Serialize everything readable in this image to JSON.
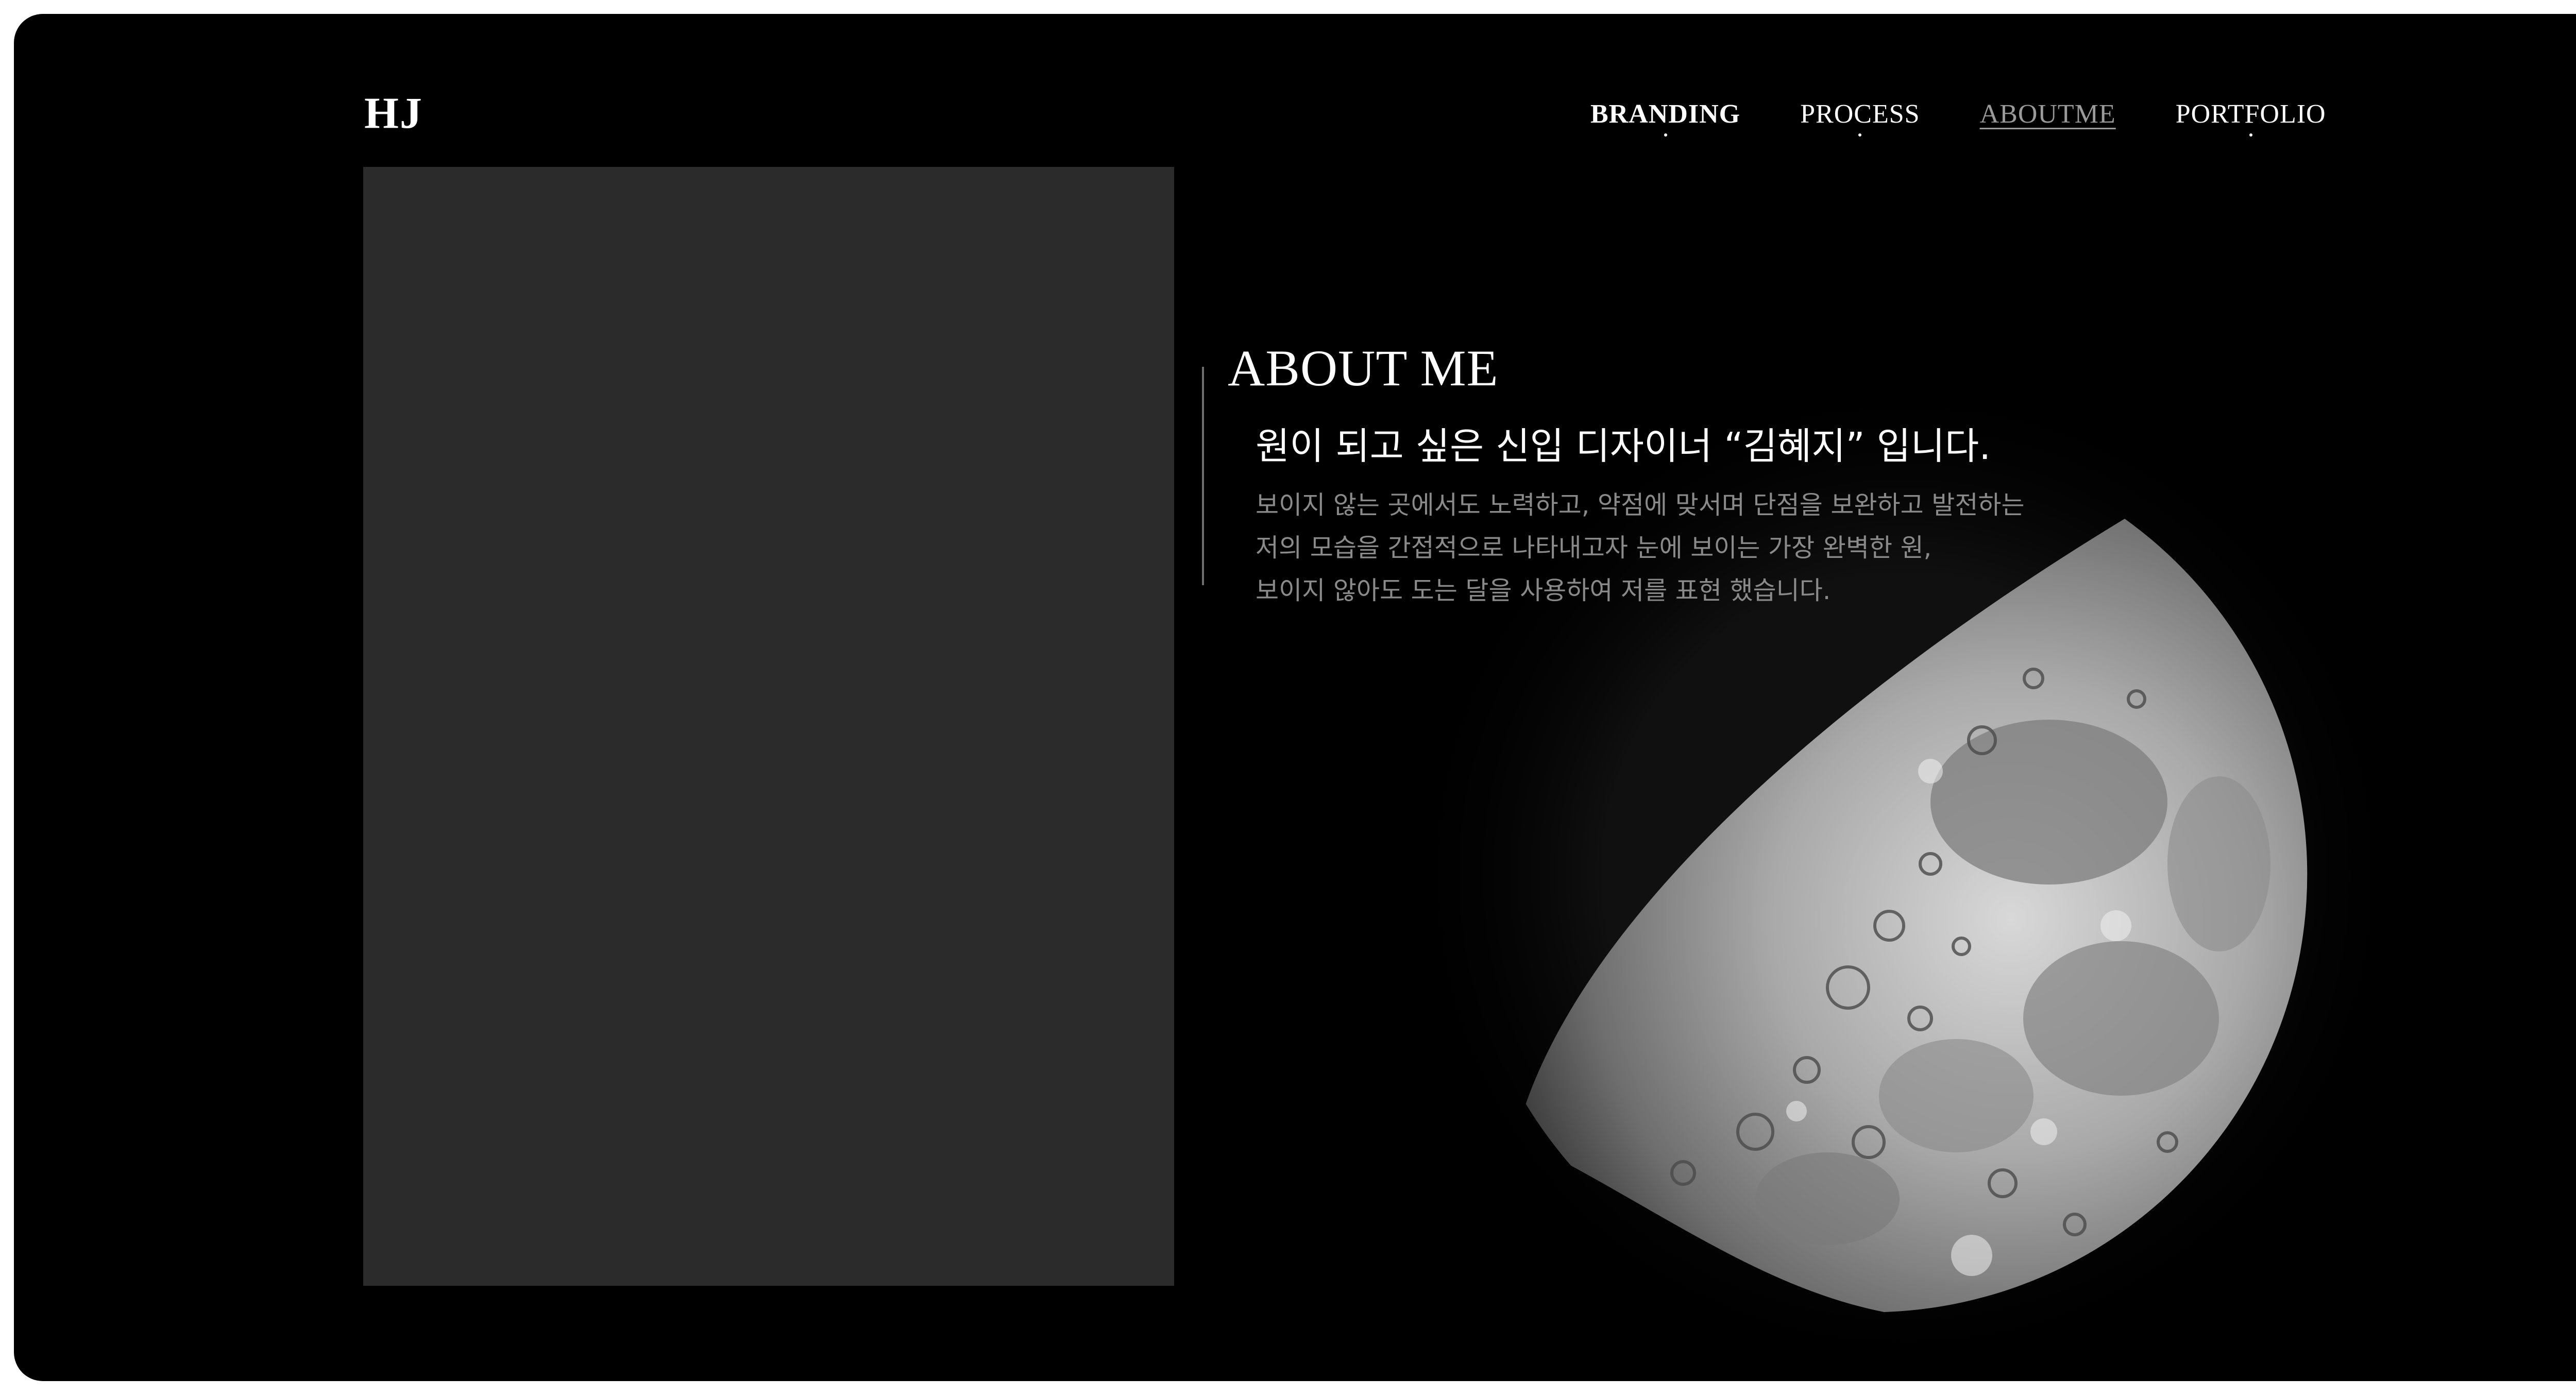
{
  "header": {
    "logo": "HJ",
    "nav": [
      {
        "label": "BRANDING"
      },
      {
        "label": "PROCESS"
      },
      {
        "label": "ABOUTME"
      },
      {
        "label": "PORTFOLIO"
      }
    ]
  },
  "about": {
    "title": "ABOUT ME",
    "subtitle": "원이 되고 싶은 신입 디자이너 “김혜지” 입니다.",
    "body": [
      "보이지 않는 곳에서도 노력하고, 약점에 맞서며 단점을 보완하고 발전하는",
      "저의 모습을 간접적으로 나타내고자 눈에 보이는 가장 완벽한 원,",
      "보이지 않아도 도는 달을 사용하여 저를 표현 했습니다."
    ]
  },
  "colors": {
    "background": "#000000",
    "photo_placeholder": "#2b2b2b",
    "text_primary": "#ffffff",
    "text_muted": "#8a8a8a",
    "nav_active": "#9a9a9a"
  },
  "icons": {
    "moon": "moon-image"
  }
}
